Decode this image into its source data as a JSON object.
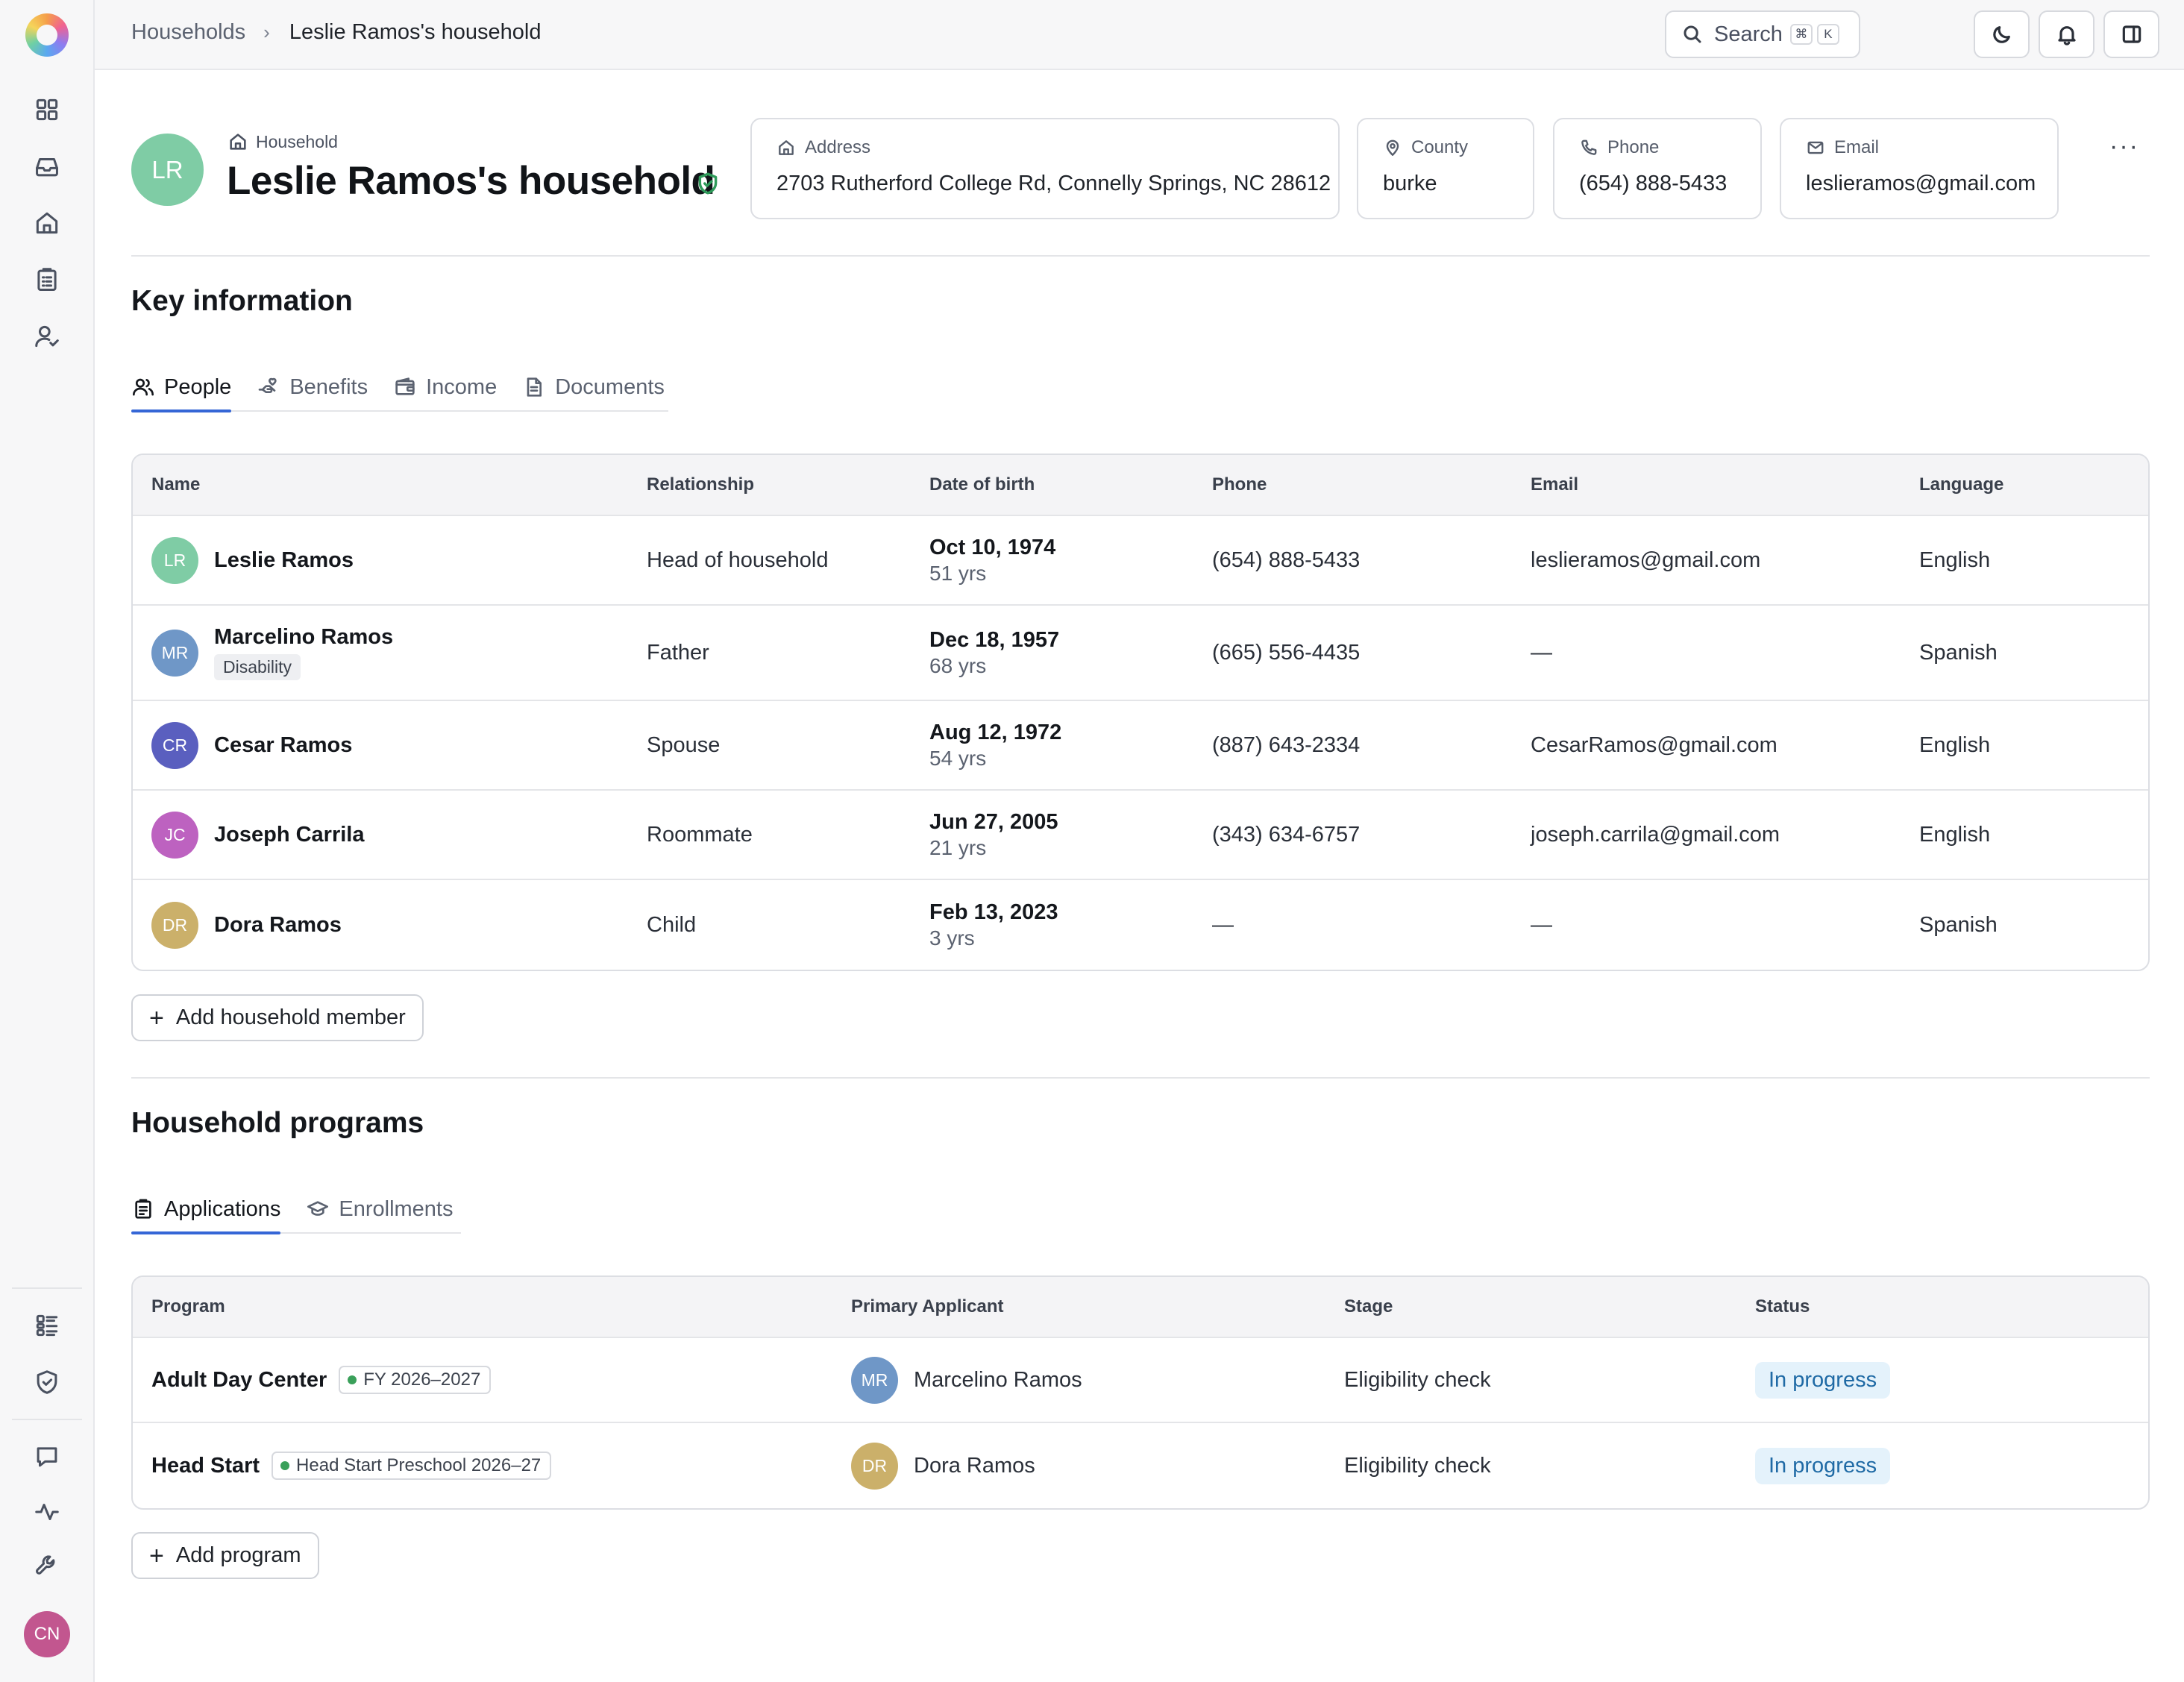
{
  "rail": {
    "avatar_initials": "CN"
  },
  "topbar": {
    "breadcrumb_parent": "Households",
    "breadcrumb_current": "Leslie Ramos's household",
    "search_label": "Search",
    "search_shortcut_1": "⌘",
    "search_shortcut_2": "K"
  },
  "household": {
    "initials": "LR",
    "kicker": "Household",
    "title": "Leslie Ramos's household",
    "cards": {
      "address_label": "Address",
      "address_value": "2703 Rutherford College Rd, Connelly Springs, NC 28612",
      "county_label": "County",
      "county_value": "burke",
      "phone_label": "Phone",
      "phone_value": "(654) 888-5433",
      "email_label": "Email",
      "email_value": "leslieramos@gmail.com"
    }
  },
  "key_info": {
    "title": "Key information",
    "tabs": [
      "People",
      "Benefits",
      "Income",
      "Documents"
    ],
    "columns": [
      "Name",
      "Relationship",
      "Date of birth",
      "Phone",
      "Email",
      "Language"
    ],
    "people": [
      {
        "initials": "LR",
        "name": "Leslie Ramos",
        "relationship": "Head of household",
        "dob": "Oct 10, 1974",
        "age": "51 yrs",
        "phone": "(654) 888-5433",
        "email": "leslieramos@gmail.com",
        "language": "English",
        "color": "#7fcca5"
      },
      {
        "initials": "MR",
        "name": "Marcelino Ramos",
        "tag": "Disability",
        "relationship": "Father",
        "dob": "Dec 18, 1957",
        "age": "68 yrs",
        "phone": "(665) 556-4435",
        "email": "—",
        "language": "Spanish",
        "color": "#6f97c7"
      },
      {
        "initials": "CR",
        "name": "Cesar Ramos",
        "relationship": "Spouse",
        "dob": "Aug 12, 1972",
        "age": "54 yrs",
        "phone": "(887) 643-2334",
        "email": "CesarRamos@gmail.com",
        "language": "English",
        "color": "#5a5fbf"
      },
      {
        "initials": "JC",
        "name": "Joseph Carrila",
        "relationship": "Roommate",
        "dob": "Jun 27, 2005",
        "age": "21 yrs",
        "phone": "(343) 634-6757",
        "email": "joseph.carrila@gmail.com",
        "language": "English",
        "color": "#bd62c0"
      },
      {
        "initials": "DR",
        "name": "Dora Ramos",
        "relationship": "Child",
        "dob": "Feb 13, 2023",
        "age": "3 yrs",
        "phone": "—",
        "email": "—",
        "language": "Spanish",
        "color": "#cbb06a"
      }
    ],
    "add_button": "Add household member"
  },
  "programs": {
    "title": "Household programs",
    "tabs": [
      "Applications",
      "Enrollments"
    ],
    "columns": [
      "Program",
      "Primary Applicant",
      "Stage",
      "Status"
    ],
    "rows": [
      {
        "program": "Adult Day Center",
        "period": "FY 2026–2027",
        "initials": "MR",
        "applicant": "Marcelino Ramos",
        "stage": "Eligibility check",
        "status": "In progress",
        "color": "#6f97c7"
      },
      {
        "program": "Head Start",
        "period": "Head Start Preschool 2026–27",
        "initials": "DR",
        "applicant": "Dora Ramos",
        "stage": "Eligibility check",
        "status": "In progress",
        "color": "#cbb06a"
      }
    ],
    "add_button": "Add program"
  }
}
